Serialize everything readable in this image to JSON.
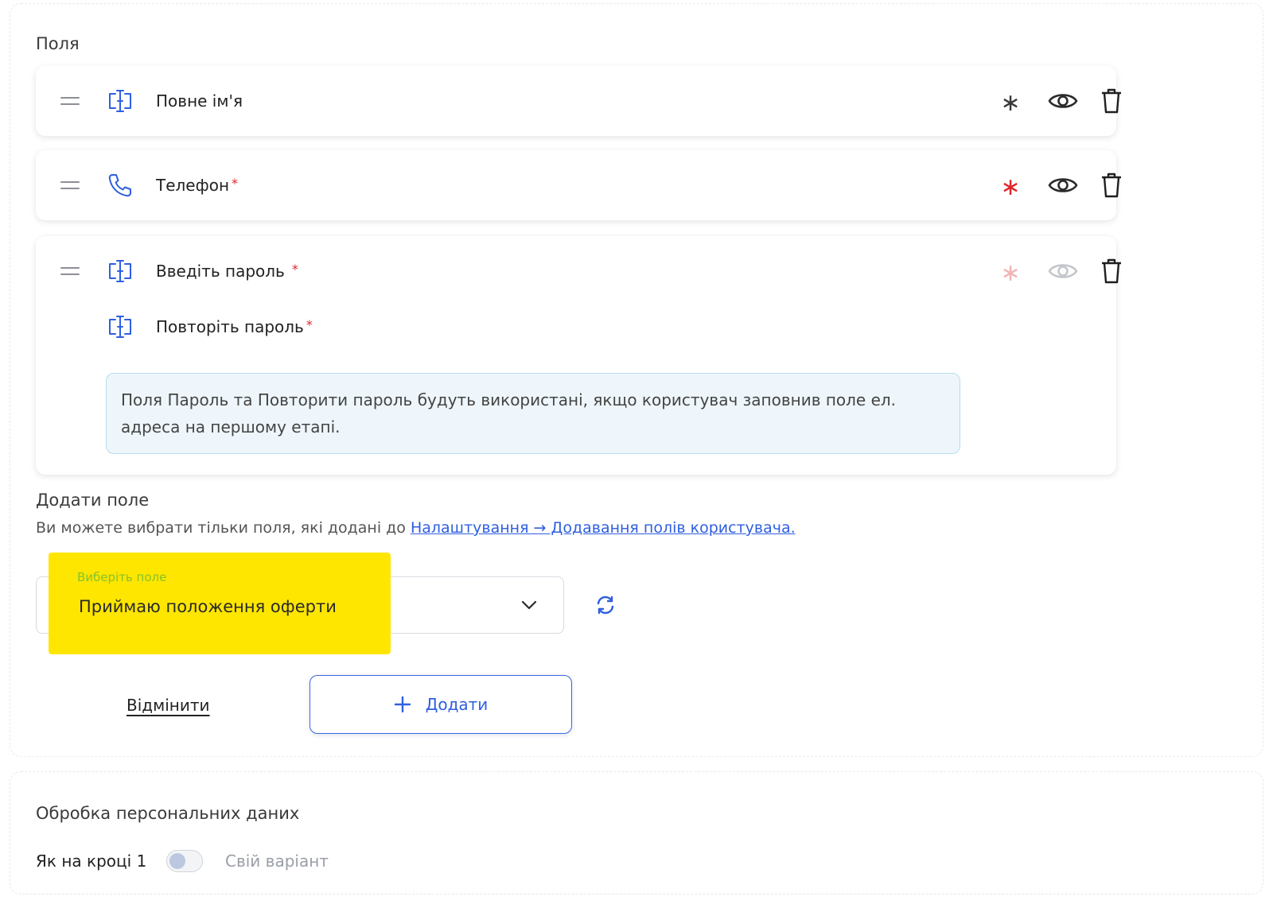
{
  "fields_section": {
    "title": "Поля",
    "fields": [
      {
        "label": "Повне ім'я",
        "required_marker": "",
        "type_icon": "text-field-icon"
      },
      {
        "label": "Телефон",
        "required_marker": "*",
        "type_icon": "phone-icon"
      },
      {
        "label": "Введіть пароль",
        "required_marker": "*",
        "type_icon": "text-field-icon"
      },
      {
        "label": "Повторіть пароль",
        "required_marker": "*",
        "type_icon": "text-field-icon"
      }
    ],
    "action_star": "∗",
    "info_text": "Поля Пароль та Повторити пароль будуть використані, якщо користувач заповнив поле ел. адреса на першому етапі."
  },
  "add_field": {
    "title": "Додати поле",
    "hint_prefix": "Ви можете вибрати тільки поля, які додані до ",
    "hint_link": "Налаштування → Додавання полів користувача.",
    "select_caption": "Виберіть поле",
    "select_value": "Приймаю положення оферти",
    "cancel_label": "Відмінити",
    "add_label": "Додати"
  },
  "personal_data": {
    "title": "Обробка персональних даних",
    "toggle_left_label": "Як на кроці 1",
    "toggle_right_label": "Свій варіант",
    "toggle_on": false
  },
  "colors": {
    "accent": "#2f5fe0",
    "required": "#e0262b",
    "highlight": "#ffe600",
    "info_bg": "#eef6fb"
  }
}
